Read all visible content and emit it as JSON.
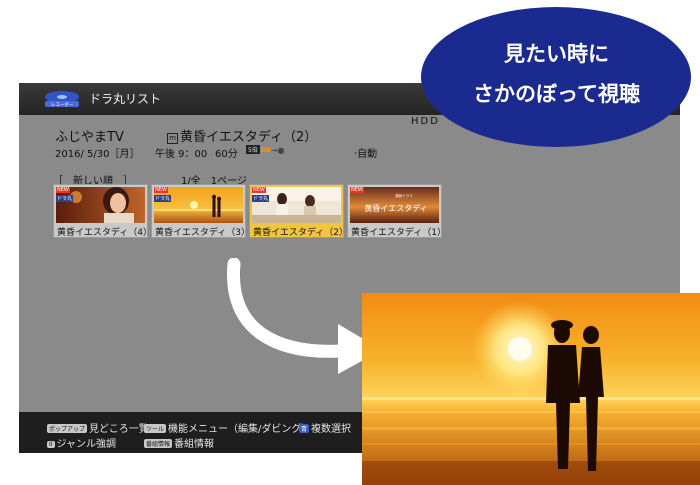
{
  "app": {
    "logo_text": "レコーダー",
    "title": "ドラ丸リスト"
  },
  "storage": {
    "label": "HDD"
  },
  "program": {
    "channel": "ふじやまTV",
    "title_mark": "m",
    "title": "黄昏イエスタディ（2）",
    "date": "2016/ 5/30［月］",
    "time": "午後 9：00",
    "duration": "60分",
    "quality_badge": "5倍",
    "record_mode": "自動"
  },
  "list": {
    "sort_label": "［　新しい順　］",
    "page_label": "1/全　1ページ",
    "items": [
      {
        "label": "黄昏イエスタディ（4）",
        "new": "NEW",
        "tag": "ドラ丸",
        "selected": false
      },
      {
        "label": "黄昏イエスタディ（3）",
        "new": "NEW",
        "tag": "ドラ丸",
        "selected": false
      },
      {
        "label": "黄昏イエスタディ（2）",
        "new": "NEW",
        "tag": "ドラ丸",
        "selected": true
      },
      {
        "label": "黄昏イエスタディ（1）",
        "new": "NEW",
        "tag": "",
        "selected": false
      }
    ],
    "thumb_caption_small": "連続ドラマ",
    "thumb_caption_title": "黄昏イエスタディ"
  },
  "footer": {
    "key_popup": "ポップアップ",
    "popup_action": "見どころ一覧",
    "key_tool": "ツール",
    "tool_action": "機能メニュー（編集/ダビング）",
    "key_blue": "青",
    "blue_action": "複数選択",
    "key_genre": "II",
    "genre_action": "ジャンル強調",
    "key_info": "番組情報",
    "info_action": "番組情報"
  },
  "callout": {
    "line1": "見たい時に",
    "line2": "さかのぼって視聴"
  },
  "colors": {
    "bubble": "#1b2a8f",
    "selected_card": "#f0c640",
    "screen_bg": "#8a8a8a"
  }
}
